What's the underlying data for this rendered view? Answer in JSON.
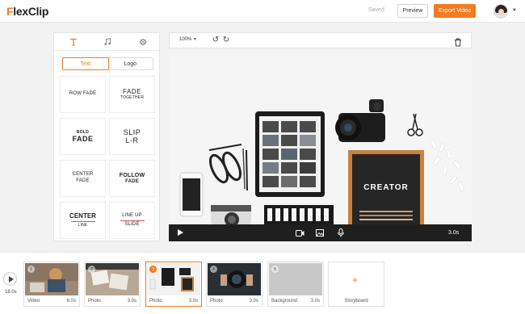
{
  "header": {
    "logo_prefix": "F",
    "logo_rest": "lexClip",
    "saved_label": "Saved",
    "preview_label": "Preview",
    "export_label": "Export Video",
    "accent_color": "#f47b21"
  },
  "left_panel": {
    "tabs": [
      "text-icon",
      "music-icon",
      "settings-icon"
    ],
    "segment": {
      "text_label": "Text",
      "logo_label": "Logo"
    },
    "cards": [
      {
        "lines": [
          "ROW FADE"
        ]
      },
      {
        "lines": [
          "FADE",
          "TOGETHER"
        ]
      },
      {
        "lines": [
          "BOLD",
          "FADE"
        ]
      },
      {
        "lines": [
          "SLIP",
          "L-R"
        ]
      },
      {
        "lines": [
          "CENTER",
          "FADE"
        ]
      },
      {
        "lines": [
          "FOLLOW",
          "FADE"
        ]
      },
      {
        "lines": [
          "CENTER",
          "LINE"
        ]
      },
      {
        "lines": [
          "LINE UP",
          "SLIDE"
        ]
      }
    ]
  },
  "canvas_toolbar": {
    "zoom": "100%"
  },
  "canvas": {
    "board_text": "CREATOR"
  },
  "control_bar": {
    "time": "3.0s"
  },
  "timeline": {
    "total": "18.0s",
    "clips": [
      {
        "num": "1",
        "type": "Video",
        "duration": "6.0s"
      },
      {
        "num": "2",
        "type": "Photo",
        "duration": "3.0s"
      },
      {
        "num": "3",
        "type": "Photo",
        "duration": "3.0s",
        "active": true
      },
      {
        "num": "4",
        "type": "Photo",
        "duration": "3.0s"
      },
      {
        "num": "5",
        "type": "Background",
        "duration": "3.0s"
      }
    ],
    "storyboard_label": "Storyboard"
  }
}
